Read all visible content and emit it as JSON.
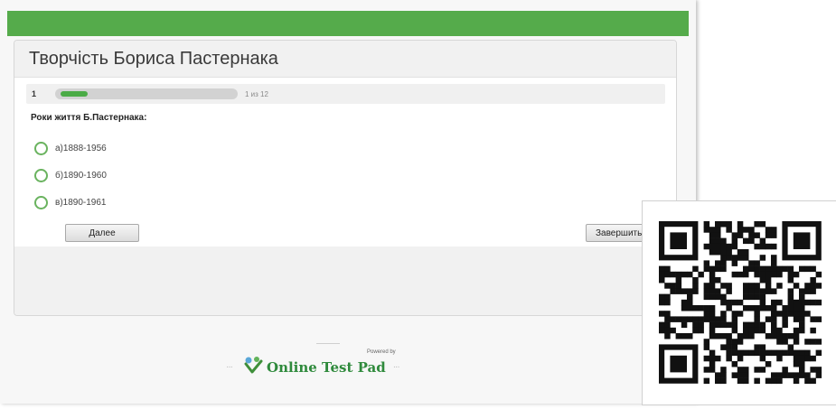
{
  "quiz": {
    "title": "Творчість Бориса Пастернака",
    "question_number": "1",
    "progress_fraction": 0.0833,
    "progress_label": "1 из 12",
    "question": "Роки життя Б.Пастернака:",
    "answers": [
      {
        "label": "а)1888-1956"
      },
      {
        "label": "б)1890-1960"
      },
      {
        "label": "в)1890-1961"
      }
    ],
    "next_button": "Далее",
    "finish_button": "Завершить"
  },
  "footer": {
    "powered_by": "Powered by",
    "brand": "Online Test Pad"
  },
  "colors": {
    "topbar": "#55ab4b",
    "accent": "#4bab46",
    "brand": "#2f8a3c"
  },
  "qr_code": {
    "icon": "qr-code"
  }
}
